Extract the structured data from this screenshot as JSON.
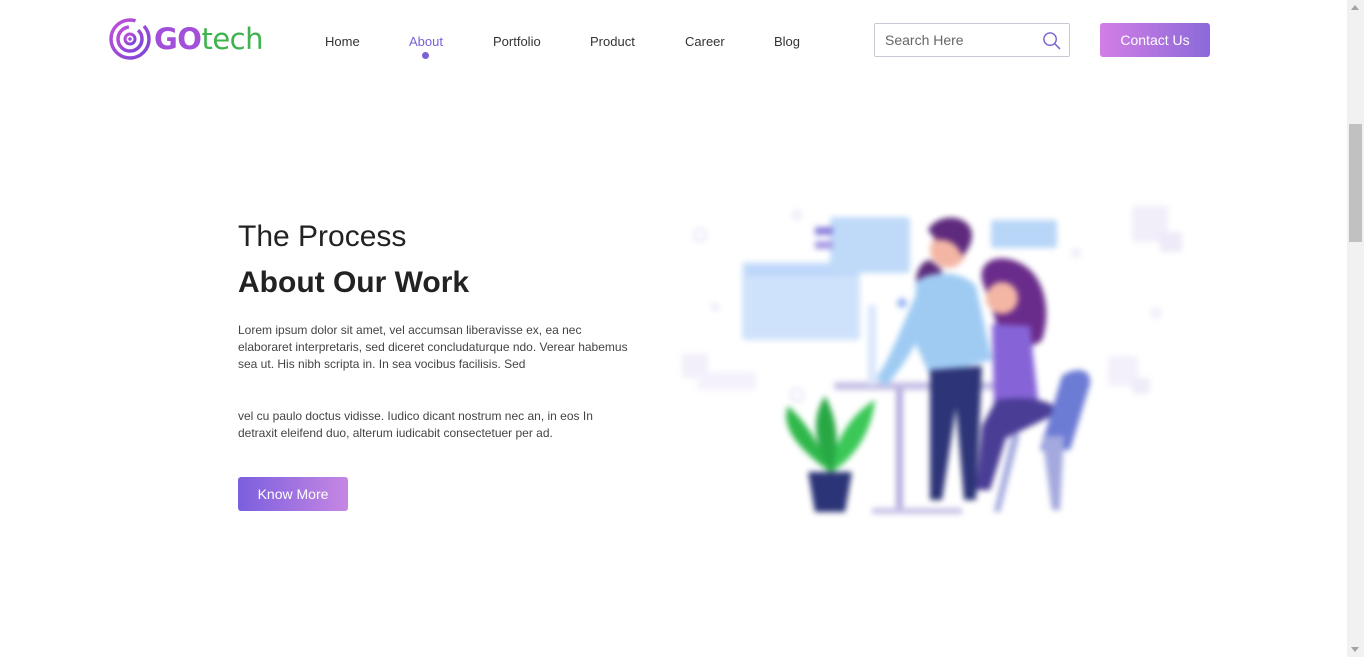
{
  "brand": {
    "go": "GO",
    "tech": "tech",
    "primary": "#a24fd9",
    "secondary": "#3fb34f"
  },
  "nav": {
    "items": [
      {
        "label": "Home"
      },
      {
        "label": "About",
        "active": true
      },
      {
        "label": "Portfolio"
      },
      {
        "label": "Product"
      },
      {
        "label": "Career"
      },
      {
        "label": "Blog"
      }
    ],
    "active_color": "#7a5fd6"
  },
  "search": {
    "placeholder": "Search Here",
    "icon": "search-icon"
  },
  "contact": {
    "label": "Contact Us"
  },
  "hero": {
    "subtitle": "The Process",
    "title": "About Our Work",
    "paragraph1": "Lorem ipsum dolor sit amet, vel accumsan liberavisse ex, ea nec elaboraret interpretaris, sed diceret concludaturque ndo. Verear habemus sea ut. His nibh scripta in. In sea vocibus facilisis. Sed",
    "paragraph2": "vel cu paulo doctus vidisse. Iudico dicant nostrum nec an, in eos In detraxit eleifend duo, alterum iudicabit consectetuer per ad.",
    "button": "Know More"
  },
  "illustration": {
    "icon": "office-work-illustration"
  }
}
